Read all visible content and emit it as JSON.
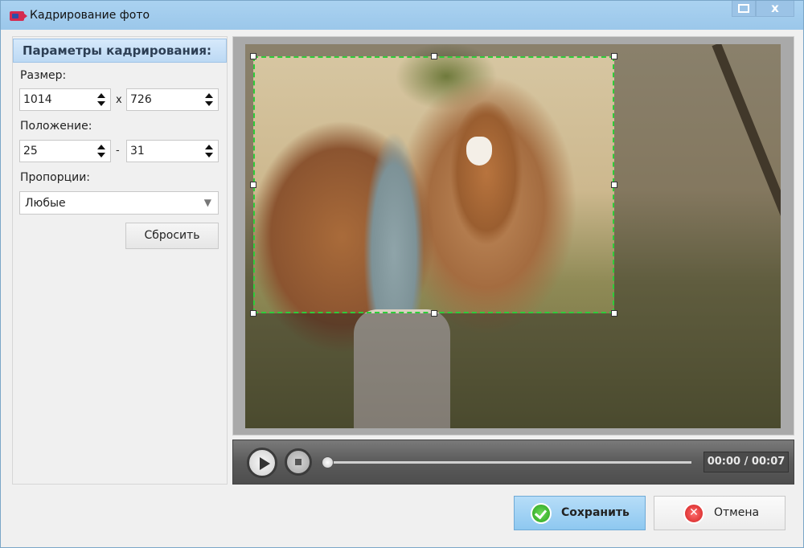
{
  "window": {
    "title": "Кадрирование фото",
    "close_label": "x"
  },
  "sidebar": {
    "header": "Параметры кадрирования:",
    "size_label": "Размер:",
    "size_width": "1014",
    "size_sep": "x",
    "size_height": "726",
    "position_label": "Положение:",
    "pos_x": "25",
    "pos_sep": "-",
    "pos_y": "31",
    "ratio_label": "Пропорции:",
    "ratio_value": "Любые",
    "reset_label": "Сбросить"
  },
  "player": {
    "time": "00:00 / 00:07",
    "progress": 0
  },
  "footer": {
    "save_label": "Сохранить",
    "cancel_label": "Отмена"
  },
  "colors": {
    "crop_border": "#2ecc3a",
    "save_button": "#8ec8f0"
  }
}
